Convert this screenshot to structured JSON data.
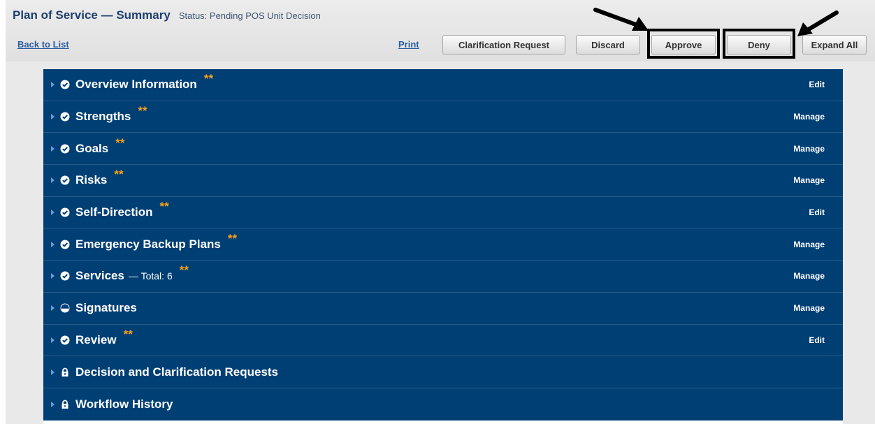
{
  "header": {
    "title": "Plan of Service — Summary",
    "status": "Status: Pending POS Unit Decision",
    "back_link": "Back to List",
    "print_link": "Print",
    "buttons": {
      "clarification": "Clarification Request",
      "discard": "Discard",
      "approve": "Approve",
      "deny": "Deny",
      "expand_all": "Expand All"
    }
  },
  "sections": [
    {
      "label": "Overview Information",
      "extra": "",
      "stars": "**",
      "action": "Edit",
      "icon": "check-circle-icon"
    },
    {
      "label": "Strengths",
      "extra": "",
      "stars": "**",
      "action": "Manage",
      "icon": "check-circle-icon"
    },
    {
      "label": "Goals",
      "extra": "",
      "stars": "**",
      "action": "Manage",
      "icon": "check-circle-icon"
    },
    {
      "label": "Risks",
      "extra": "",
      "stars": "**",
      "action": "Manage",
      "icon": "check-circle-icon"
    },
    {
      "label": "Self-Direction",
      "extra": "",
      "stars": "**",
      "action": "Edit",
      "icon": "check-circle-icon"
    },
    {
      "label": "Emergency Backup Plans",
      "extra": "",
      "stars": "**",
      "action": "Manage",
      "icon": "check-circle-icon"
    },
    {
      "label": "Services",
      "extra": "— Total: 6",
      "stars": "**",
      "action": "Manage",
      "icon": "check-circle-icon"
    },
    {
      "label": "Signatures",
      "extra": "",
      "stars": "",
      "action": "Manage",
      "icon": "half-circle-icon"
    },
    {
      "label": "Review",
      "extra": "",
      "stars": "**",
      "action": "Edit",
      "icon": "check-circle-icon"
    },
    {
      "label": "Decision and Clarification Requests",
      "extra": "",
      "stars": "",
      "action": "",
      "icon": "lock-icon"
    },
    {
      "label": "Workflow History",
      "extra": "",
      "stars": "",
      "action": "",
      "icon": "lock-icon"
    }
  ],
  "colors": {
    "section_bg": "#003f74",
    "star": "#f4a11d",
    "title": "#1d3f6d",
    "link": "#2a5da0"
  }
}
